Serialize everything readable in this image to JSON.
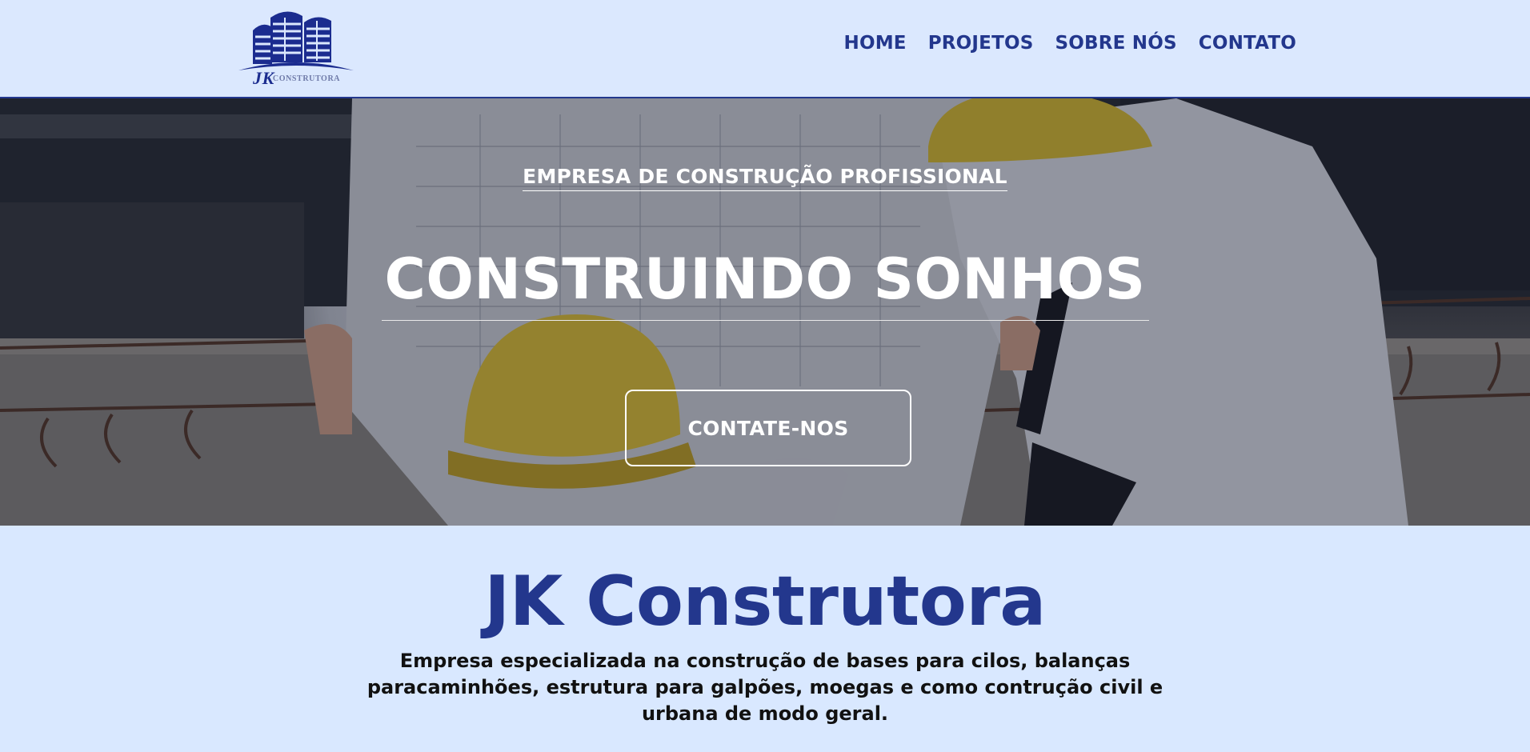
{
  "brand": {
    "logo_initials": "JK",
    "logo_wordmark": "CONSTRUTORA",
    "color_primary": "#23378d",
    "color_background": "#d9e8ff"
  },
  "nav": {
    "items": [
      {
        "label": "HOME"
      },
      {
        "label": "PROJETOS"
      },
      {
        "label": "SOBRE NÓS"
      },
      {
        "label": "CONTATO"
      }
    ]
  },
  "hero": {
    "kicker": "EMPRESA DE CONSTRUÇÃO PROFISSIONAL",
    "title": "CONSTRUINDO SONHOS",
    "cta_label": "CONTATE-NOS"
  },
  "about": {
    "title": "JK Construtora",
    "description": "Empresa especializada na construção de bases para cilos, balanças paracaminhões, estrutura para galpões, moegas e como contrução civil e urbana de modo geral."
  }
}
